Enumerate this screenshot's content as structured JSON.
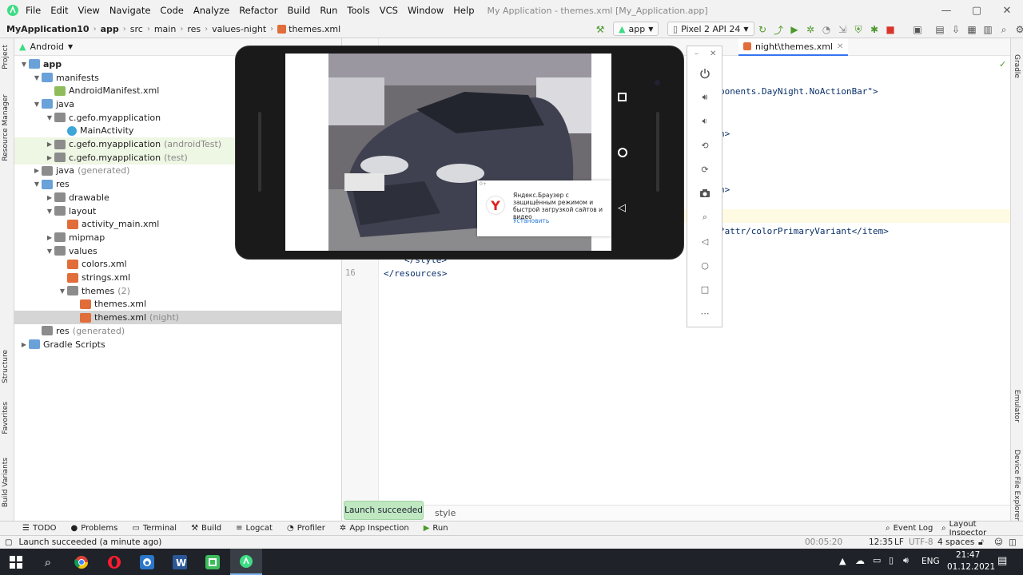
{
  "window": {
    "title": "My Application - themes.xml [My_Application.app]",
    "menu": [
      "File",
      "Edit",
      "View",
      "Navigate",
      "Code",
      "Analyze",
      "Refactor",
      "Build",
      "Run",
      "Tools",
      "VCS",
      "Window",
      "Help"
    ]
  },
  "nav": {
    "breadcrumb": [
      "MyApplication10",
      "app",
      "src",
      "main",
      "res",
      "values-night",
      "themes.xml"
    ],
    "run_config": "app",
    "device": "Pixel 2 API 24"
  },
  "left_strip": [
    "Project",
    "Resource Manager",
    "Structure",
    "Favorites",
    "Build Variants"
  ],
  "right_strip": [
    "Gradle",
    "Emulator",
    "Device File Explorer"
  ],
  "project": {
    "view": "Android",
    "tree": [
      {
        "label": "app",
        "suffix": ""
      },
      {
        "label": "manifests",
        "suffix": ""
      },
      {
        "label": "AndroidManifest.xml",
        "suffix": ""
      },
      {
        "label": "java",
        "suffix": ""
      },
      {
        "label": "c.gefo.myapplication",
        "suffix": ""
      },
      {
        "label": "MainActivity",
        "suffix": ""
      },
      {
        "label": "c.gefo.myapplication",
        "suffix": "(androidTest)"
      },
      {
        "label": "c.gefo.myapplication",
        "suffix": "(test)"
      },
      {
        "label": "java",
        "suffix": "(generated)"
      },
      {
        "label": "res",
        "suffix": ""
      },
      {
        "label": "drawable",
        "suffix": ""
      },
      {
        "label": "layout",
        "suffix": ""
      },
      {
        "label": "activity_main.xml",
        "suffix": ""
      },
      {
        "label": "mipmap",
        "suffix": ""
      },
      {
        "label": "values",
        "suffix": ""
      },
      {
        "label": "colors.xml",
        "suffix": ""
      },
      {
        "label": "strings.xml",
        "suffix": ""
      },
      {
        "label": "themes",
        "suffix": "(2)"
      },
      {
        "label": "themes.xml",
        "suffix": ""
      },
      {
        "label": "themes.xml",
        "suffix": "(night)"
      },
      {
        "label": "res",
        "suffix": "(generated)"
      },
      {
        "label": "Gradle Scripts",
        "suffix": ""
      }
    ]
  },
  "editor": {
    "tab": "night\\themes.xml",
    "lines": [
      {
        "text": "ponents.DayNight.NoActionBar\">"
      },
      {
        "text": "n>"
      },
      {
        "text": "n>"
      },
      {
        "text": "?attr/colorPrimaryVariant</item>"
      },
      {
        "text": "</style>"
      },
      {
        "text": "</resources>"
      }
    ],
    "line_number": "16",
    "breadcrumb": "style"
  },
  "emulator": {
    "ad_badge": "0+",
    "ad_text": "Яндекс.Браузер с защищённым режимом и быстрой загрузкой сайтов и видео",
    "ad_button": "Установить"
  },
  "toast": "Launch succeeded",
  "tool_windows": [
    "TODO",
    "Problems",
    "Terminal",
    "Build",
    "Logcat",
    "Profiler",
    "App Inspection",
    "Run"
  ],
  "right_tools": [
    "Event Log",
    "Layout Inspector"
  ],
  "status": {
    "message": "Launch succeeded (a minute ago)",
    "timer": "00:05:20",
    "position": "12:35",
    "line_sep": "LF",
    "encoding": "UTF-8",
    "indent": "4 spaces"
  },
  "taskbar": {
    "lang": "ENG",
    "time": "21:47",
    "date": "01.12.2021"
  },
  "colors": {
    "android_green": "#a4c639",
    "accent": "#3574f0",
    "selection": "#d5d5d5"
  }
}
